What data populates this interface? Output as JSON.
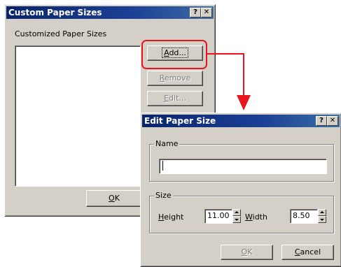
{
  "back_dialog": {
    "title": "Custom Paper Sizes",
    "help_btn": "?",
    "close_btn": "✕",
    "list_label": "Customized Paper Sizes",
    "add_prefix": "A",
    "add_rest": "dd...",
    "remove_prefix": "R",
    "remove_rest": "emove",
    "edit_prefix": "E",
    "edit_rest": "dit...",
    "ok_prefix": "O",
    "ok_rest": "K"
  },
  "edit_dialog": {
    "title": "Edit Paper Size",
    "help_btn": "?",
    "close_btn": "✕",
    "name_group": "Name",
    "name_value": "",
    "size_group": "Size",
    "height_prefix": "H",
    "height_rest": "eight",
    "height_value": "11.00",
    "width_prefix": "W",
    "width_rest": "idth",
    "width_value": "8.50",
    "ok_prefix": "O",
    "ok_rest": "K",
    "cancel_prefix": "C",
    "cancel_rest": "ancel"
  },
  "colors": {
    "highlight": "#e8141e",
    "title_bar": "#0a246a"
  }
}
